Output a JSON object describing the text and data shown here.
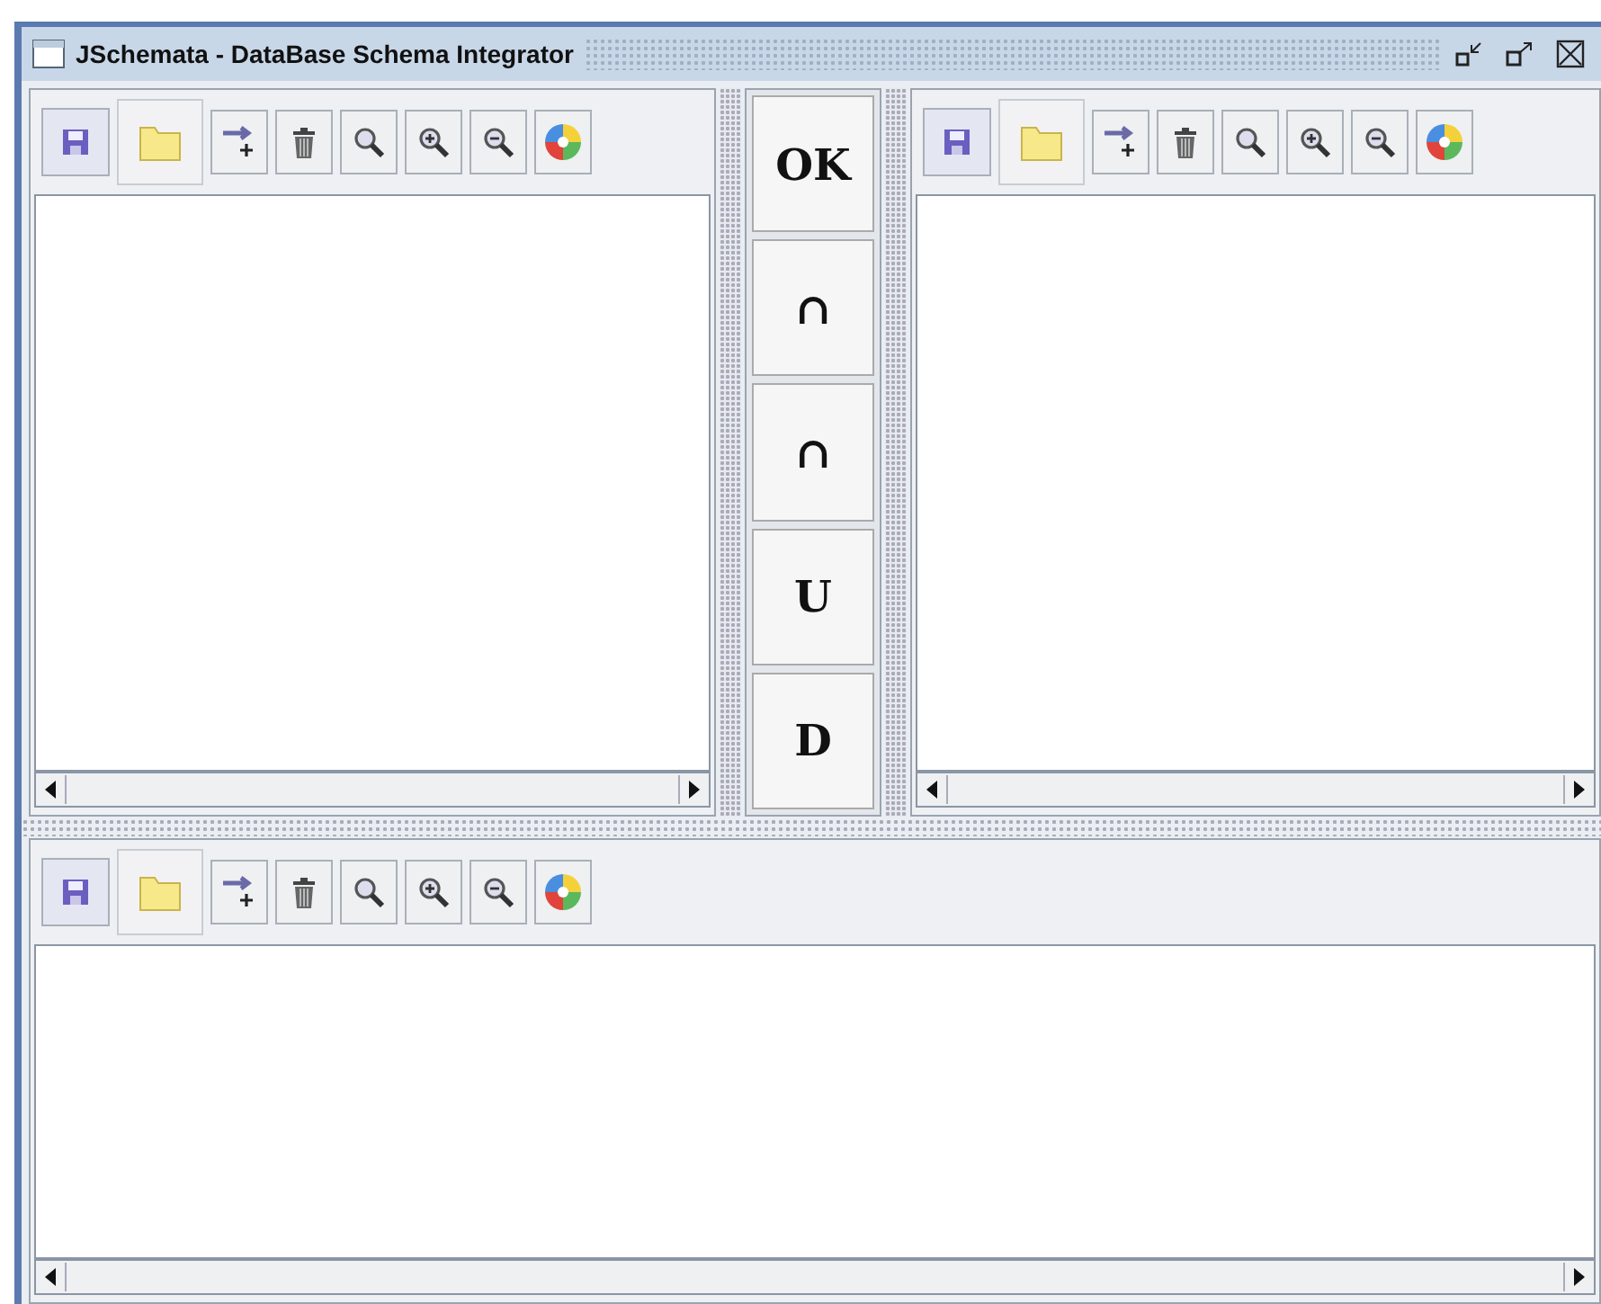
{
  "window": {
    "title": "JSchemata - DataBase Schema Integrator"
  },
  "operation_buttons": [
    {
      "label": "OK"
    },
    {
      "label": "∩"
    },
    {
      "label": "∩"
    },
    {
      "label": "U"
    },
    {
      "label": "D"
    }
  ]
}
